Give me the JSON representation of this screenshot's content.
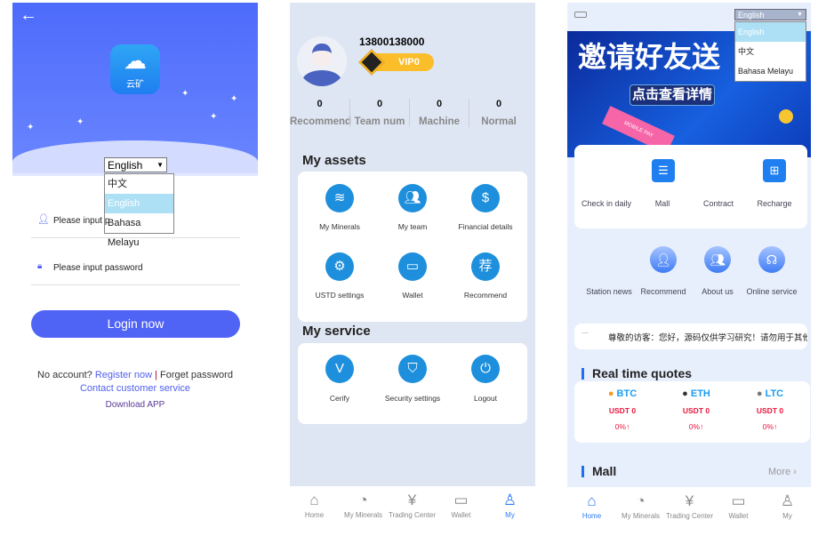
{
  "login": {
    "back_icon": "arrow-left-icon",
    "app_icon_label": "云矿",
    "language_select": {
      "value": "English",
      "options": [
        "中文",
        "English",
        "Bahasa Melayu"
      ],
      "highlighted": "English"
    },
    "phone_placeholder": "Please input p",
    "password_placeholder": "Please input password",
    "login_button": "Login now",
    "no_account": "No account?",
    "register": "Register now",
    "separator": "|",
    "forget": "Forget password",
    "contact": "Contact customer service",
    "download": "Download APP",
    "accent": "#4f63f5"
  },
  "profile": {
    "phone": "13800138000",
    "vip": "VIP0",
    "stats": [
      {
        "value": "0",
        "label": "Recommend"
      },
      {
        "value": "0",
        "label": "Team num"
      },
      {
        "value": "0",
        "label": "Machine"
      },
      {
        "value": "0",
        "label": "Normal"
      }
    ],
    "assets_title": "My assets",
    "assets": [
      {
        "label": "My Minerals",
        "icon": "database-icon"
      },
      {
        "label": "My team",
        "icon": "team-icon"
      },
      {
        "label": "Financial details",
        "icon": "dollar-icon"
      },
      {
        "label": "USTD settings",
        "icon": "gear-icon"
      },
      {
        "label": "Wallet",
        "icon": "card-icon"
      },
      {
        "label": "Recommend",
        "icon": "recommend-icon"
      }
    ],
    "service_title": "My service",
    "services": [
      {
        "label": "Cerify",
        "icon": "check-icon"
      },
      {
        "label": "Security settings",
        "icon": "shield-icon"
      },
      {
        "label": "Logout",
        "icon": "power-icon"
      }
    ],
    "nav": [
      "Home",
      "My Minerals",
      "Trading Center",
      "Wallet",
      "My"
    ],
    "nav_active": "My"
  },
  "home": {
    "language_select": {
      "value": "English",
      "options": [
        "English",
        "中文",
        "Bahasa Melayu"
      ],
      "highlighted": "English"
    },
    "banner_title": "邀请好友送",
    "banner_button": "点击查看详情",
    "banner_tag": "MOBILE PAY",
    "quick": [
      "Check in daily",
      "Mall",
      "Contract",
      "Recharge"
    ],
    "quick2": [
      "Station news",
      "Recommend",
      "About us",
      "Online service"
    ],
    "notice": "尊敬的访客：您好，源码仅供学习研究！请勿用于其他",
    "quotes_title": "Real time quotes",
    "quotes": [
      {
        "coin": "BTC",
        "price": "USDT 0",
        "change": "0%",
        "arrow": "↑"
      },
      {
        "coin": "ETH",
        "price": "USDT 0",
        "change": "0%",
        "arrow": "↑"
      },
      {
        "coin": "LTC",
        "price": "USDT 0",
        "change": "0%",
        "arrow": "↑"
      }
    ],
    "mall_title": "Mall",
    "more": "More",
    "nav": [
      "Home",
      "My Minerals",
      "Trading Center",
      "Wallet",
      "My"
    ],
    "nav_active": "Home"
  }
}
